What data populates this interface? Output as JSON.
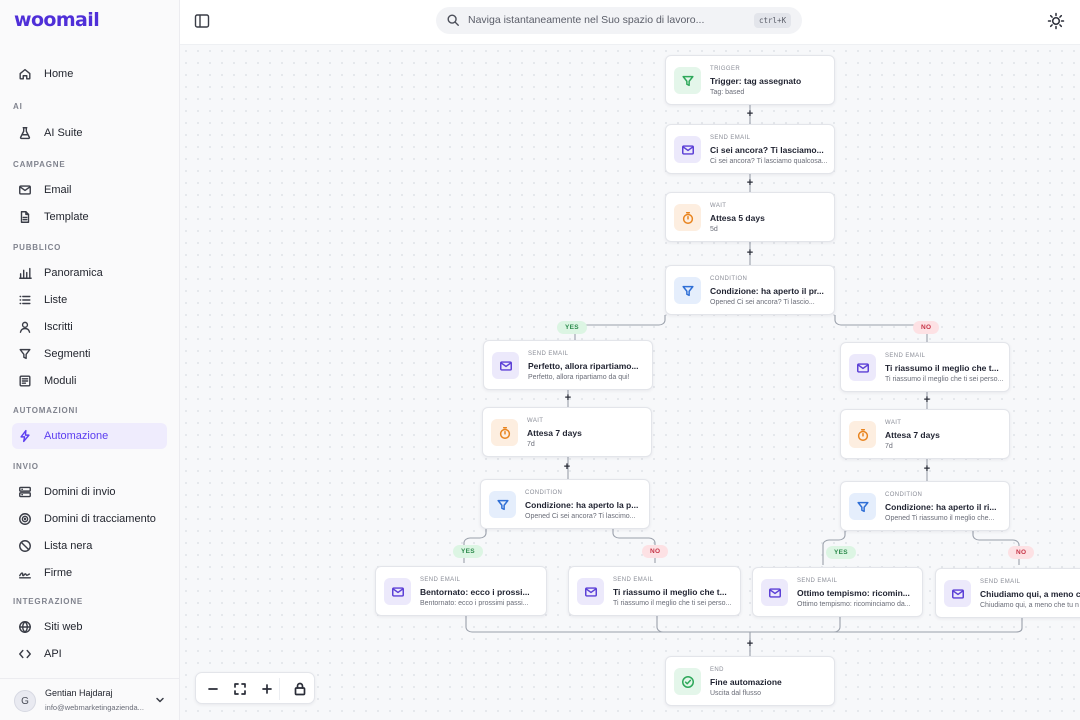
{
  "app": {
    "logo": "woomail"
  },
  "sidebar": {
    "home": "Home",
    "sections": {
      "ai": "AI",
      "campagne": "CAMPAGNE",
      "pubblico": "PUBBLICO",
      "automazioni": "AUTOMAZIONI",
      "invio": "INVIO",
      "integrazione": "INTEGRAZIONE"
    },
    "items": {
      "ai_suite": "AI Suite",
      "email": "Email",
      "template": "Template",
      "panoramica": "Panoramica",
      "liste": "Liste",
      "iscritti": "Iscritti",
      "segmenti": "Segmenti",
      "moduli": "Moduli",
      "automazione": "Automazione",
      "domini_invio": "Domini di invio",
      "domini_tracciamento": "Domini di tracciamento",
      "lista_nera": "Lista nera",
      "firme": "Firme",
      "siti_web": "Siti web",
      "api": "API"
    },
    "user": {
      "initial": "G",
      "name": "Gentian Hajdaraj",
      "email": "info@webmarketingazienda..."
    }
  },
  "topbar": {
    "search_placeholder": "Naviga istantaneamente nel Suo spazio di lavoro...",
    "shortcut": "ctrl+K"
  },
  "flow": {
    "trigger": {
      "type": "TRIGGER",
      "title": "Trigger: tag assegnato",
      "sub": "Tag: based"
    },
    "send1": {
      "type": "SEND EMAIL",
      "title": "Ci sei ancora? Ti lasciamo...",
      "sub": "Ci sei ancora? Ti lasciamo qualcosa..."
    },
    "wait1": {
      "type": "WAIT",
      "title": "Attesa 5 days",
      "sub": "5d"
    },
    "cond1": {
      "type": "CONDITION",
      "title": "Condizione: ha aperto il pr...",
      "sub": "Opened Ci sei ancora? Ti lascio..."
    },
    "yes1": "YES",
    "no1": "NO",
    "send_l": {
      "type": "SEND EMAIL",
      "title": "Perfetto, allora ripartiamo...",
      "sub": "Perfetto, allora ripartiamo da qui!"
    },
    "send_r": {
      "type": "SEND EMAIL",
      "title": "Ti riassumo il meglio che t...",
      "sub": "Ti riassumo il meglio che ti sei perso..."
    },
    "wait_l": {
      "type": "WAIT",
      "title": "Attesa 7 days",
      "sub": "7d"
    },
    "wait_r": {
      "type": "WAIT",
      "title": "Attesa 7 days",
      "sub": "7d"
    },
    "cond_l": {
      "type": "CONDITION",
      "title": "Condizione: ha aperto la p...",
      "sub": "Opened Ci sei ancora? Ti lascimo..."
    },
    "cond_r": {
      "type": "CONDITION",
      "title": "Condizione: ha aperto il ri...",
      "sub": "Opened Ti riassumo il meglio che..."
    },
    "yes_l": "YES",
    "no_l": "NO",
    "yes_r": "YES",
    "no_r": "NO",
    "send_ll": {
      "type": "SEND EMAIL",
      "title": "Bentornato: ecco i prossi...",
      "sub": "Bentornato: ecco i prossimi passi..."
    },
    "send_lr": {
      "type": "SEND EMAIL",
      "title": "Ti riassumo il meglio che t...",
      "sub": "Ti riassumo il meglio che ti sei perso..."
    },
    "send_rl": {
      "type": "SEND EMAIL",
      "title": "Ottimo tempismo: ricomin...",
      "sub": "Ottimo tempismo: ricominciamo da..."
    },
    "send_rr": {
      "type": "SEND EMAIL",
      "title": "Chiudiamo qui, a meno che",
      "sub": "Chiudiamo qui, a meno che tu n"
    },
    "end": {
      "type": "END",
      "title": "Fine automazione",
      "sub": "Uscita dal flusso"
    }
  },
  "colors": {
    "accent": "#5b3df0",
    "yes": "#2b8a4b",
    "no": "#c63447"
  }
}
